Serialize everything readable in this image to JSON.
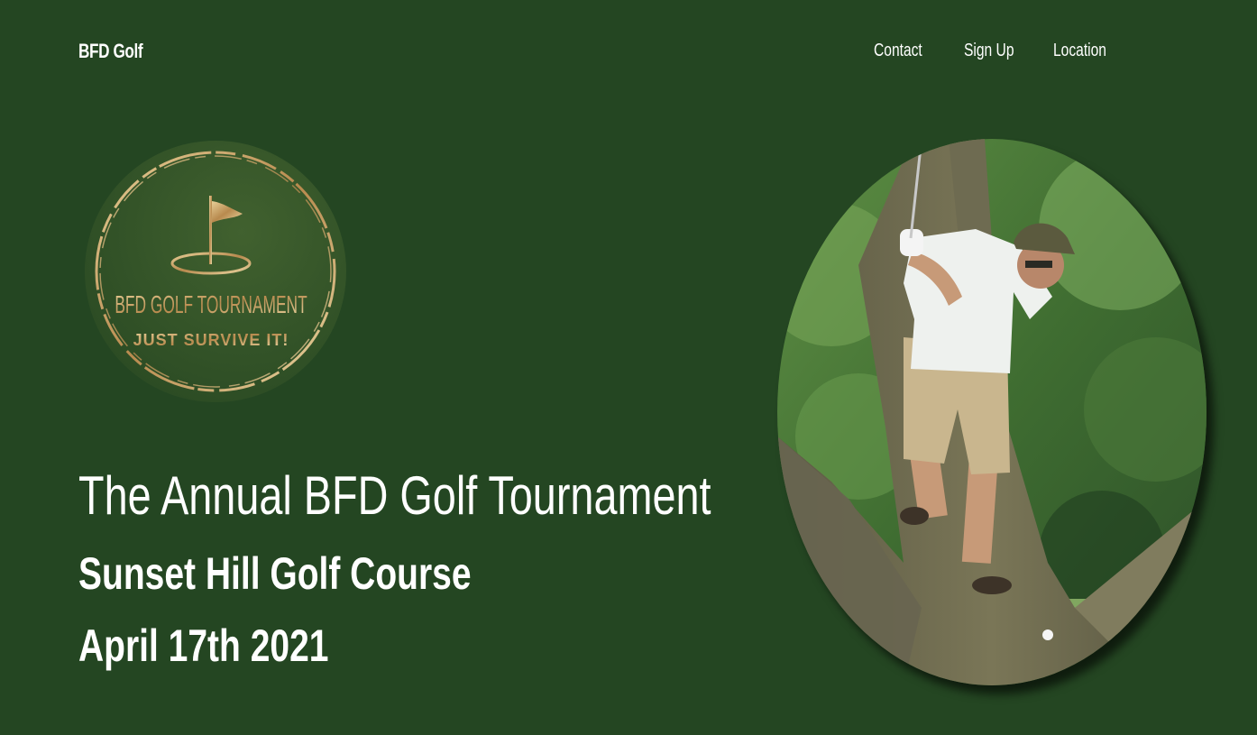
{
  "header": {
    "brand": "BFD Golf",
    "nav": [
      {
        "label": "Contact"
      },
      {
        "label": "Sign Up"
      },
      {
        "label": "Location"
      }
    ]
  },
  "logo": {
    "line1": "BFD GOLF TOURNAMENT",
    "line2": "JUST SURVIVE IT!"
  },
  "hero": {
    "title": "The Annual BFD Golf Tournament",
    "venue": "Sunset Hill Golf Course",
    "date": "April 17th 2021"
  },
  "colors": {
    "background": "#244622",
    "text": "#ffffff",
    "gold": "#c9a86a"
  }
}
